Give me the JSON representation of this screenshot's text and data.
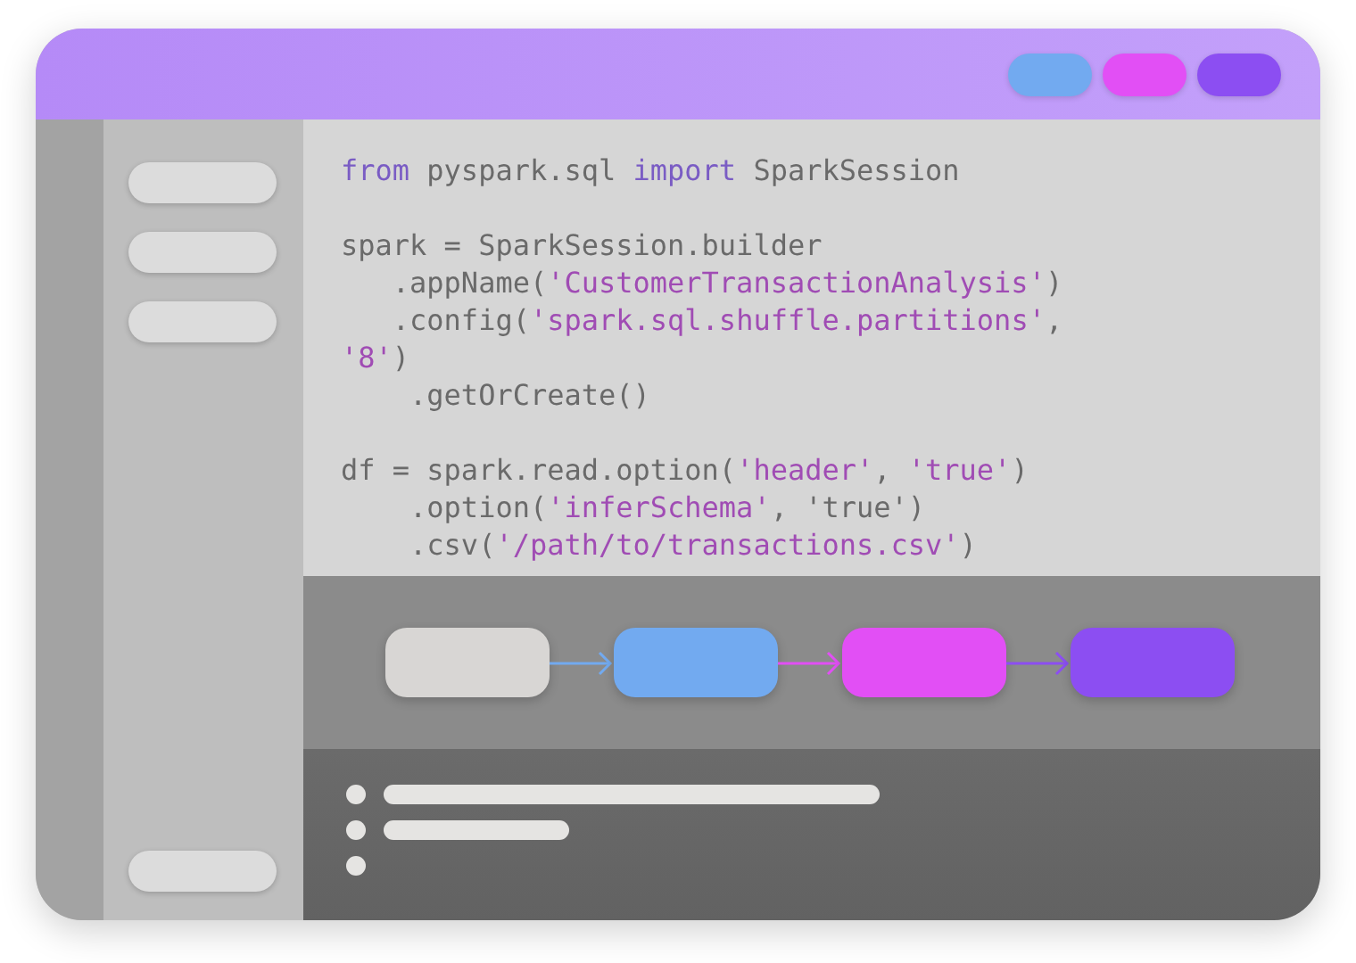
{
  "title_bar": {
    "buttons": [
      {
        "color": "#72aaf0"
      },
      {
        "color": "#e24ff5"
      },
      {
        "color": "#8c4ef2"
      }
    ]
  },
  "sidebar": {
    "items": [
      {
        "kind": "top"
      },
      {
        "kind": "top"
      },
      {
        "kind": "top"
      },
      {
        "kind": "bottom"
      }
    ]
  },
  "code": {
    "lines": [
      {
        "kind": "code",
        "tokens": [
          {
            "text": "from",
            "kind": "keyword"
          },
          {
            "text": " pyspark.sql ",
            "kind": "plain"
          },
          {
            "text": "import",
            "kind": "keyword"
          },
          {
            "text": " SparkSession",
            "kind": "plain"
          }
        ]
      },
      {
        "kind": "blank"
      },
      {
        "kind": "code",
        "tokens": [
          {
            "text": "spark = SparkSession.builder",
            "kind": "plain"
          }
        ]
      },
      {
        "kind": "code",
        "tokens": [
          {
            "text": "   .appName(",
            "kind": "plain"
          },
          {
            "text": "'CustomerTransactionAnalysis'",
            "kind": "string"
          },
          {
            "text": ")",
            "kind": "plain"
          }
        ]
      },
      {
        "kind": "code",
        "tokens": [
          {
            "text": "   .config(",
            "kind": "plain"
          },
          {
            "text": "'spark.sql.shuffle.partitions'",
            "kind": "string"
          },
          {
            "text": ",",
            "kind": "plain"
          }
        ]
      },
      {
        "kind": "code",
        "tokens": [
          {
            "text": "'8'",
            "kind": "string"
          },
          {
            "text": ")",
            "kind": "plain"
          }
        ]
      },
      {
        "kind": "code",
        "tokens": [
          {
            "text": "    .getOrCreate()",
            "kind": "plain"
          }
        ]
      },
      {
        "kind": "blank"
      },
      {
        "kind": "code",
        "tokens": [
          {
            "text": "df = spark.read.option(",
            "kind": "plain"
          },
          {
            "text": "'header'",
            "kind": "string"
          },
          {
            "text": ", ",
            "kind": "plain"
          },
          {
            "text": "'true'",
            "kind": "string"
          },
          {
            "text": ")",
            "kind": "plain"
          }
        ]
      },
      {
        "kind": "code",
        "tokens": [
          {
            "text": "    .option(",
            "kind": "plain"
          },
          {
            "text": "'inferSchema'",
            "kind": "string"
          },
          {
            "text": ", 'true')",
            "kind": "plain"
          }
        ]
      },
      {
        "kind": "code",
        "tokens": [
          {
            "text": "    .csv(",
            "kind": "plain"
          },
          {
            "text": "'/path/to/transactions.csv'",
            "kind": "string"
          },
          {
            "text": ")",
            "kind": "plain"
          }
        ]
      }
    ]
  },
  "pipeline": {
    "nodes": [
      {
        "color": "#d8d6d4"
      },
      {
        "color": "#72aaf0"
      },
      {
        "color": "#e24ff5"
      },
      {
        "color": "#8c4ef2"
      }
    ]
  },
  "console": {
    "lines": [
      {
        "kind": "long"
      },
      {
        "kind": "short"
      },
      {
        "kind": "empty"
      }
    ]
  }
}
